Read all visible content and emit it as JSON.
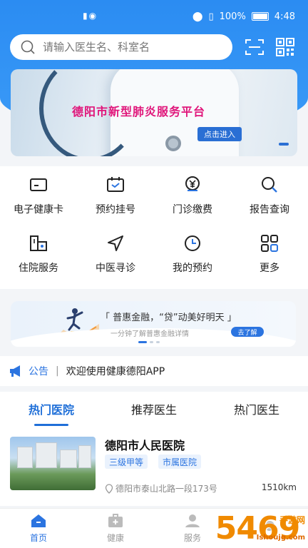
{
  "status_bar": {
    "signal": "ᵢₗ",
    "battery_pct": "100%",
    "time": "4:48"
  },
  "search": {
    "placeholder": "请输入医生名、科室名"
  },
  "banner": {
    "title": "德阳市新型肺炎服务平台",
    "enter_label": "点击进入"
  },
  "grid": [
    {
      "label": "电子健康卡",
      "icon": "card-icon"
    },
    {
      "label": "预约挂号",
      "icon": "calendar-check-icon"
    },
    {
      "label": "门诊缴费",
      "icon": "yuan-payment-icon"
    },
    {
      "label": "报告查询",
      "icon": "search-icon"
    },
    {
      "label": "住院服务",
      "icon": "hospital-bed-icon"
    },
    {
      "label": "中医寻诊",
      "icon": "navigation-icon"
    },
    {
      "label": "我的预约",
      "icon": "clock-icon"
    },
    {
      "label": "更多",
      "icon": "grid-more-icon"
    }
  ],
  "promo": {
    "title": "「 普惠金融，“贷”动美好明天 」",
    "subtitle": "一分钟了解普惠金融详情",
    "button": "去了解"
  },
  "notice": {
    "tag": "公告",
    "separator": "|",
    "text": "欢迎使用健康德阳APP"
  },
  "tabs": [
    {
      "label": "热门医院",
      "active": true
    },
    {
      "label": "推荐医生",
      "active": false
    },
    {
      "label": "热门医生",
      "active": false
    }
  ],
  "hospital": {
    "name": "德阳市人民医院",
    "tags": [
      "三级甲等",
      "市属医院"
    ],
    "address": "德阳市泰山北路一段173号",
    "distance": "1510km"
  },
  "bottom_nav": [
    {
      "label": "首页",
      "active": true,
      "icon": "home-icon"
    },
    {
      "label": "健康",
      "active": false,
      "icon": "medical-kit-icon"
    },
    {
      "label": "服务",
      "active": false,
      "icon": "service-icon"
    }
  ],
  "watermark": {
    "text": "5469",
    "sub": "手游网",
    "url": "Ishoujg.com"
  },
  "colors": {
    "primary": "#2b8cf2",
    "accent_blue": "#1f6fd8",
    "banner_title": "#e0157a"
  }
}
